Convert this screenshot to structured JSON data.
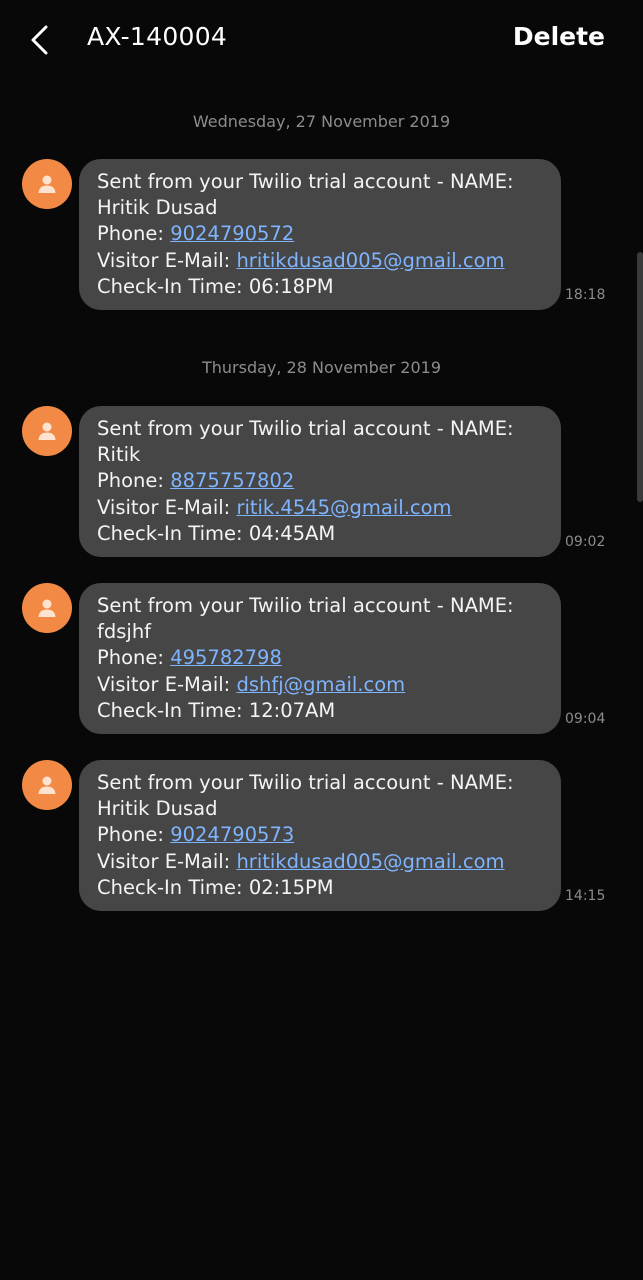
{
  "header": {
    "title": "AX-140004",
    "delete_label": "Delete"
  },
  "groups": [
    {
      "date": "Wednesday, 27 November 2019",
      "messages": [
        {
          "line1": "Sent from your Twilio trial account - NAME:",
          "name": "Hritik Dusad",
          "phone_label": "Phone: ",
          "phone": "9024790572",
          "email_label": "Visitor E-Mail: ",
          "email": "hritikdusad005@gmail.com",
          "checkin": "Check-In Time: 06:18PM",
          "time": "18:18"
        }
      ]
    },
    {
      "date": "Thursday, 28 November 2019",
      "messages": [
        {
          "line1": "Sent from your Twilio trial account - NAME:",
          "name": "Ritik",
          "phone_label": "Phone: ",
          "phone": "8875757802",
          "email_label": "Visitor E-Mail: ",
          "email": "ritik.4545@gmail.com",
          "checkin": "Check-In Time: 04:45AM",
          "time": "09:02"
        },
        {
          "line1": "Sent from your Twilio trial account - NAME:",
          "name": "fdsjhf",
          "phone_label": "Phone: ",
          "phone": "495782798",
          "email_label": "Visitor E-Mail: ",
          "email": "dshfj@gmail.com",
          "checkin": "Check-In Time: 12:07AM",
          "time": "09:04"
        },
        {
          "line1": "Sent from your Twilio trial account - NAME:",
          "name": "Hritik Dusad",
          "phone_label": "Phone: ",
          "phone": "9024790573",
          "email_label": "Visitor E-Mail: ",
          "email": "hritikdusad005@gmail.com",
          "checkin": "Check-In Time: 02:15PM",
          "time": "14:15"
        }
      ]
    }
  ],
  "icons": {
    "back": "chevron-left-icon",
    "avatar": "person-icon"
  },
  "colors": {
    "background": "#080808",
    "bubble": "#464646",
    "avatar": "#f28a45",
    "link": "#7fb4ff",
    "muted": "#8c8c8c"
  }
}
